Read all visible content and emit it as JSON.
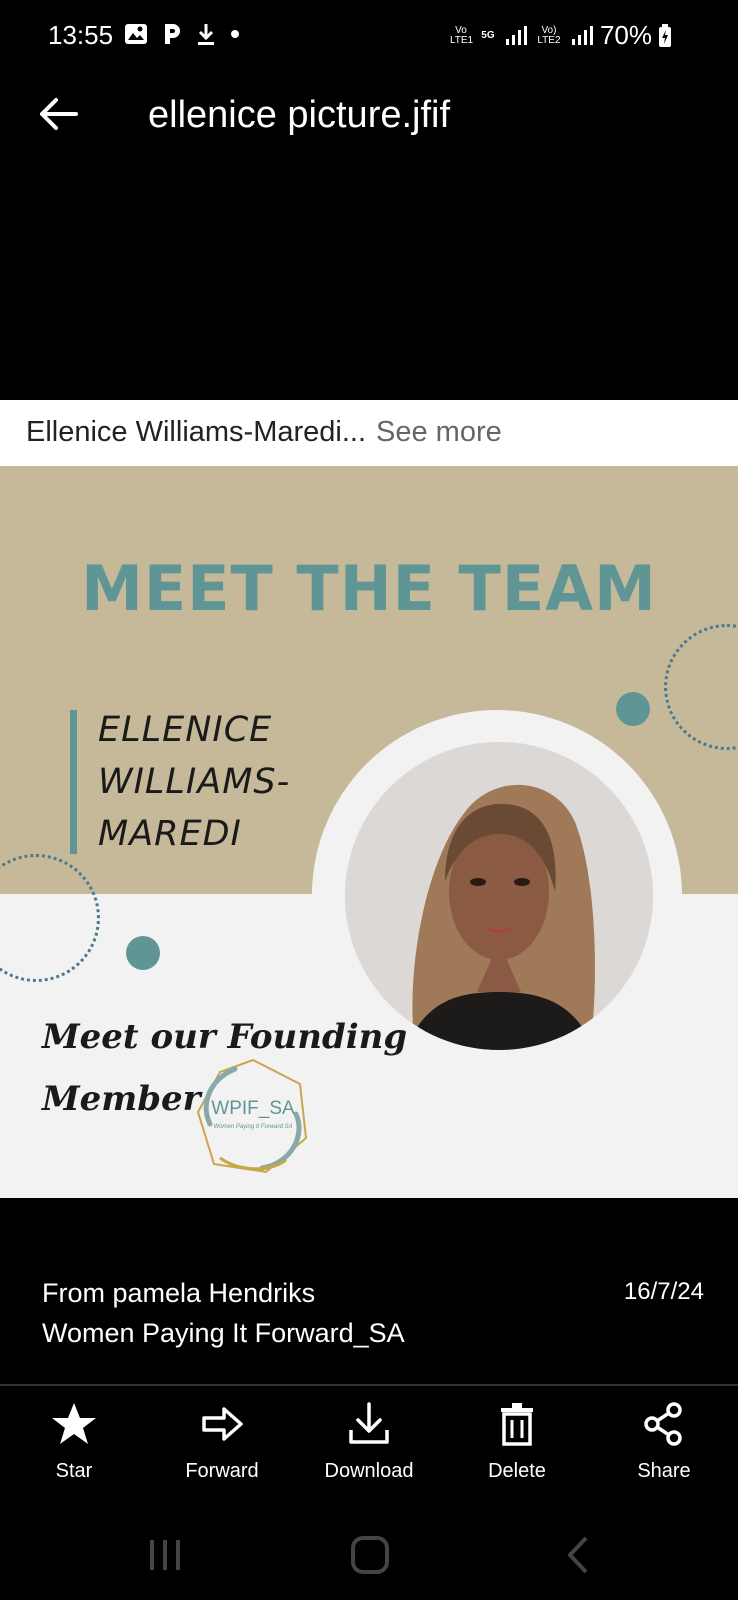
{
  "status_bar": {
    "time": "13:55",
    "network_labels": [
      "Vo LTE1",
      "5G",
      "Vo) LTE2"
    ],
    "battery": "70%"
  },
  "header": {
    "title": "ellenice picture.jfif"
  },
  "caption": {
    "text": "Ellenice Williams-Maredi...",
    "see_more": "See more"
  },
  "image": {
    "headline": "MEET THE TEAM",
    "name_lines": [
      "ELLENICE",
      "WILLIAMS-",
      "MAREDI"
    ],
    "tagline_lines": [
      "Meet our Founding",
      "Member"
    ],
    "logo_text": "WPIF_SA",
    "logo_subtext": "Women Paying It Forward SA",
    "colors": {
      "tan": "#c6b999",
      "teal": "#5f9695",
      "light": "#f2f2f2"
    }
  },
  "meta": {
    "from": "From pamela Hendriks",
    "group": "Women Paying It Forward_SA",
    "date": "16/7/24"
  },
  "actions": [
    {
      "label": "Star",
      "icon": "star-icon"
    },
    {
      "label": "Forward",
      "icon": "forward-arrow-icon"
    },
    {
      "label": "Download",
      "icon": "download-icon"
    },
    {
      "label": "Delete",
      "icon": "trash-icon"
    },
    {
      "label": "Share",
      "icon": "share-icon"
    }
  ],
  "navbar": {
    "icons": [
      "recent-apps-icon",
      "home-icon",
      "back-nav-icon"
    ]
  }
}
